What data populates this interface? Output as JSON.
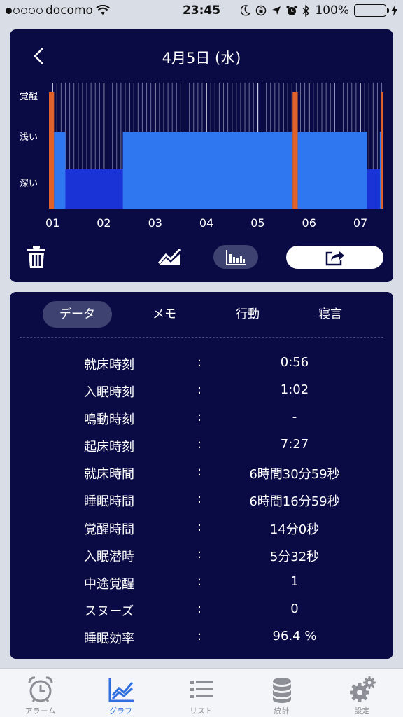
{
  "status_bar": {
    "carrier": "docomo",
    "time": "23:45",
    "battery_text": "100%",
    "battery_level": 1.0,
    "signal_bars": 1,
    "icons": [
      "signal-dots-icon",
      "wifi-icon",
      "moon-icon",
      "lock-rotation-icon",
      "location-arrow-icon",
      "alarm-clock-icon",
      "bluetooth-icon",
      "battery-icon",
      "charging-bolt-icon"
    ]
  },
  "header": {
    "title": "4月5日 (水)",
    "back_icon": "chevron-left-icon"
  },
  "chart_data": {
    "type": "area",
    "y_categories": [
      "覚醒",
      "浅い",
      "深い"
    ],
    "x_tick_labels": [
      "01",
      "02",
      "03",
      "04",
      "05",
      "06",
      "07"
    ],
    "x_range_hours": [
      0.93,
      7.45
    ],
    "segments": [
      {
        "start": 0.93,
        "end": 1.03,
        "stage": "覚醒"
      },
      {
        "start": 1.03,
        "end": 1.25,
        "stage": "浅い"
      },
      {
        "start": 1.25,
        "end": 2.37,
        "stage": "深い"
      },
      {
        "start": 2.37,
        "end": 5.68,
        "stage": "浅い"
      },
      {
        "start": 5.68,
        "end": 5.78,
        "stage": "覚醒"
      },
      {
        "start": 5.78,
        "end": 7.13,
        "stage": "浅い"
      },
      {
        "start": 7.13,
        "end": 7.38,
        "stage": "深い"
      },
      {
        "start": 7.38,
        "end": 7.41,
        "stage": "浅い"
      },
      {
        "start": 7.41,
        "end": 7.45,
        "stage": "覚醒"
      }
    ],
    "colors": {
      "awake": "#e0622a",
      "light": "#2f77f0",
      "deep": "#1a33d6",
      "background": "#0a0a45"
    }
  },
  "toolbar": {
    "delete_icon": "trash-icon",
    "line_view_icon": "line-chart-icon",
    "bar_view_icon": "bar-chart-icon",
    "share_icon": "share-icon"
  },
  "tabs": [
    {
      "label": "データ",
      "active": true
    },
    {
      "label": "メモ",
      "active": false
    },
    {
      "label": "行動",
      "active": false
    },
    {
      "label": "寝言",
      "active": false
    }
  ],
  "stats": [
    {
      "label": "就床時刻",
      "colon": ":",
      "value": "0:56"
    },
    {
      "label": "入眠時刻",
      "colon": ":",
      "value": "1:02"
    },
    {
      "label": "鳴動時刻",
      "colon": ":",
      "value": "-"
    },
    {
      "label": "起床時刻",
      "colon": ":",
      "value": "7:27"
    },
    {
      "label": "就床時間",
      "colon": ":",
      "value": "6時間30分59秒"
    },
    {
      "label": "睡眠時間",
      "colon": ":",
      "value": "6時間16分59秒"
    },
    {
      "label": "覚醒時間",
      "colon": ":",
      "value": "14分0秒"
    },
    {
      "label": "入眠潜時",
      "colon": ":",
      "value": "5分32秒"
    },
    {
      "label": "中途覚醒",
      "colon": ":",
      "value": "1"
    },
    {
      "label": "スヌーズ",
      "colon": ":",
      "value": "0"
    },
    {
      "label": "睡眠効率",
      "colon": ":",
      "value": "96.4 %"
    }
  ],
  "tab_bar": [
    {
      "label": "アラーム",
      "icon": "alarm-clock-icon",
      "active": false
    },
    {
      "label": "グラフ",
      "icon": "line-chart-icon",
      "active": true
    },
    {
      "label": "リスト",
      "icon": "list-icon",
      "active": false
    },
    {
      "label": "統計",
      "icon": "database-icon",
      "active": false
    },
    {
      "label": "設定",
      "icon": "gear-icon",
      "active": false
    }
  ]
}
